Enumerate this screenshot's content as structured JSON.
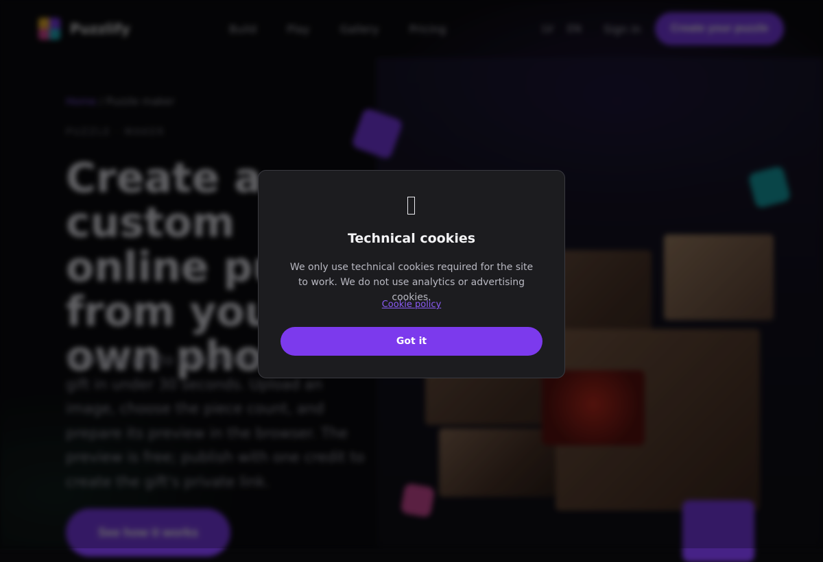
{
  "nav": {
    "brand": "Puzzlify",
    "links": [
      "Build",
      "Play",
      "Gallery",
      "Pricing"
    ],
    "lang_primary": "LV",
    "lang_secondary": "EN",
    "sign_in": "Sign in",
    "cta": "Create your puzzle"
  },
  "hero": {
    "breadcrumb_home": "Home",
    "breadcrumb_sep": "/",
    "breadcrumb_current": "Puzzle maker",
    "eyebrow": "PUZZLE · MAKER",
    "headline": "Create a custom online puzzle from your own photo",
    "description": "Turn any photo into an interactive puzzle gift in under 30 seconds. Upload an image, choose the piece count, and prepare its preview in the browser. The preview is free; publish with one credit to create the gift's private link.",
    "button": "See how it works"
  },
  "cookie_modal": {
    "icon": "cookie-icon",
    "title": "Technical cookies",
    "body": "We only use technical cookies required for the site to work. We do not use analytics or advertising cookies.",
    "policy_link": "Cookie policy",
    "accept_button": "Got it"
  },
  "colors": {
    "accent": "#7c3aed",
    "modal_bg": "#1c1c1f",
    "page_bg": "#060608"
  }
}
